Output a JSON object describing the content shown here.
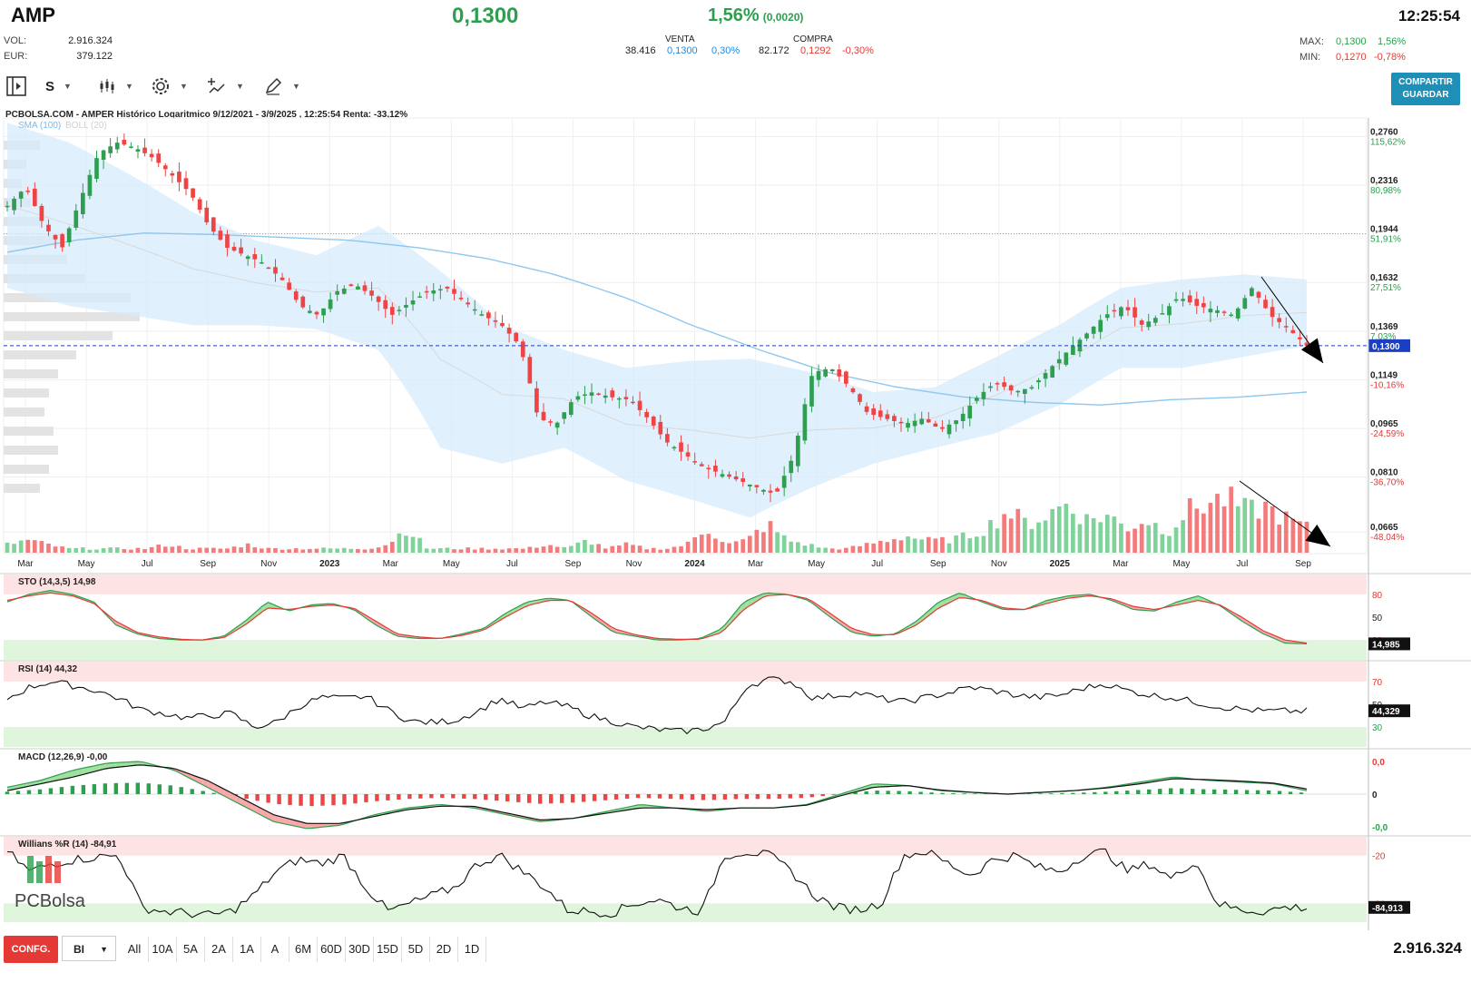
{
  "header": {
    "ticker": "AMP",
    "price": "0,1300",
    "change_pct": "1,56%",
    "change_abs": "(0,0020)",
    "time": "12:25:54",
    "vol_label": "VOL:",
    "vol_value": "2.916.324",
    "eur_label": "EUR:",
    "eur_value": "379.122",
    "max_label": "MAX:",
    "max_price": "0,1300",
    "max_pct": "1,56%",
    "min_label": "MIN:",
    "min_price": "0,1270",
    "min_pct": "-0,78%"
  },
  "orderbook": {
    "sell_label": "VENTA",
    "sell_qty": "38.416",
    "sell_price": "0,1300",
    "sell_pct": "0,30%",
    "buy_label": "COMPRA",
    "buy_qty": "82.172",
    "buy_price": "0,1292",
    "buy_pct": "-0,30%"
  },
  "toolbar": {
    "period_label": "S",
    "share_line1": "COMPARTIR",
    "share_line2": "GUARDAR"
  },
  "bottom": {
    "config_label": "CONFG.",
    "select_value": "BI",
    "ranges": [
      "All",
      "10A",
      "5A",
      "2A",
      "1A",
      "A",
      "6M",
      "60D",
      "30D",
      "15D",
      "5D",
      "2D",
      "1D"
    ],
    "total_volume": "2.916.324"
  },
  "chart_data": {
    "type": "candlestick",
    "title": "PCBOLSA.COM - AMPER Histórico Logaritmico 9/12/2021 - 3/9/2025 , 12:25:54 Renta: -33,12%",
    "legend": [
      "SMA (100)",
      "BOLL (20)"
    ],
    "scale": "log",
    "current_price": 0.13,
    "current_price_label": "0,1300",
    "y_ticks": [
      {
        "value": 0.276,
        "label": "0,2760",
        "pct": "115,62%"
      },
      {
        "value": 0.2316,
        "label": "0,2316",
        "pct": "80,98%"
      },
      {
        "value": 0.1944,
        "label": "0,1944",
        "pct": "51,91%"
      },
      {
        "value": 0.1632,
        "label": "0,1632",
        "pct": "27,51%"
      },
      {
        "value": 0.1369,
        "label": "0,1369",
        "pct": "7,03%"
      },
      {
        "value": 0.1149,
        "label": "0,1149",
        "pct": "-10,16%"
      },
      {
        "value": 0.0965,
        "label": "0,0965",
        "pct": "-24,59%"
      },
      {
        "value": 0.081,
        "label": "0,0810",
        "pct": "-36,70%"
      },
      {
        "value": 0.0665,
        "label": "0,0665",
        "pct": "-48,04%"
      }
    ],
    "x_ticks": [
      "Mar",
      "May",
      "Jul",
      "Sep",
      "Nov",
      "2023",
      "Mar",
      "May",
      "Jul",
      "Sep",
      "Nov",
      "2024",
      "Mar",
      "May",
      "Jul",
      "Sep",
      "Nov",
      "2025",
      "Mar",
      "May",
      "Jul",
      "Sep"
    ],
    "close_path": [
      0.215,
      0.23,
      0.2,
      0.185,
      0.22,
      0.26,
      0.27,
      0.265,
      0.255,
      0.24,
      0.225,
      0.2,
      0.185,
      0.18,
      0.175,
      0.165,
      0.15,
      0.145,
      0.158,
      0.162,
      0.155,
      0.145,
      0.152,
      0.158,
      0.16,
      0.152,
      0.145,
      0.14,
      0.13,
      0.1,
      0.098,
      0.108,
      0.11,
      0.108,
      0.107,
      0.1,
      0.092,
      0.088,
      0.084,
      0.082,
      0.08,
      0.078,
      0.076,
      0.088,
      0.118,
      0.12,
      0.112,
      0.102,
      0.1,
      0.098,
      0.1,
      0.096,
      0.1,
      0.108,
      0.114,
      0.11,
      0.112,
      0.12,
      0.128,
      0.136,
      0.145,
      0.15,
      0.14,
      0.145,
      0.155,
      0.15,
      0.148,
      0.145,
      0.16,
      0.145,
      0.138,
      0.13
    ],
    "sma100_path": [
      0.182,
      0.19,
      0.195,
      0.194,
      0.192,
      0.19,
      0.185,
      0.178,
      0.168,
      0.155,
      0.14,
      0.128,
      0.118,
      0.112,
      0.108,
      0.106,
      0.105,
      0.107,
      0.108,
      0.11
    ],
    "boll_upper_path": [
      0.29,
      0.27,
      0.24,
      0.21,
      0.19,
      0.18,
      0.2,
      0.17,
      0.14,
      0.128,
      0.12,
      0.123,
      0.124,
      0.118,
      0.11,
      0.112,
      0.125,
      0.14,
      0.16,
      0.165,
      0.168,
      0.165
    ],
    "boll_lower_path": [
      0.16,
      0.15,
      0.145,
      0.14,
      0.14,
      0.138,
      0.128,
      0.09,
      0.085,
      0.09,
      0.08,
      0.075,
      0.07,
      0.078,
      0.085,
      0.09,
      0.095,
      0.105,
      0.12,
      0.12,
      0.125,
      0.13
    ],
    "volume_path": [
      2,
      3,
      2,
      1,
      1,
      1,
      1,
      1,
      2,
      1,
      1,
      1,
      2,
      1,
      1,
      1,
      1,
      1,
      1,
      2,
      6,
      1,
      1,
      1,
      1,
      1,
      1,
      2,
      1,
      3,
      1,
      2,
      1,
      1,
      2,
      6,
      2,
      3,
      7,
      3,
      2,
      1,
      1,
      2,
      3,
      4,
      3,
      3,
      4,
      6,
      10,
      7,
      9,
      12,
      8,
      9,
      6,
      8,
      5,
      10,
      12,
      13,
      10,
      11,
      8,
      6
    ],
    "indicators": [
      {
        "name": "STO (14,3,5)",
        "value": "14,98",
        "last_label": "14,985",
        "levels": [
          "80",
          "50",
          "20"
        ],
        "k_path": [
          70,
          80,
          85,
          80,
          70,
          40,
          28,
          22,
          20,
          20,
          25,
          45,
          70,
          58,
          66,
          68,
          60,
          40,
          25,
          22,
          22,
          28,
          35,
          55,
          70,
          75,
          72,
          50,
          30,
          25,
          20,
          20,
          22,
          35,
          70,
          82,
          80,
          72,
          50,
          30,
          25,
          28,
          45,
          70,
          82,
          70,
          60,
          60,
          72,
          78,
          80,
          72,
          60,
          58,
          70,
          78,
          65,
          45,
          28,
          16,
          15
        ],
        "d_path": [
          72,
          78,
          82,
          78,
          68,
          45,
          30,
          24,
          21,
          20,
          23,
          40,
          62,
          60,
          64,
          66,
          62,
          45,
          28,
          24,
          22,
          26,
          33,
          50,
          65,
          72,
          72,
          55,
          35,
          27,
          22,
          21,
          21,
          30,
          60,
          78,
          80,
          74,
          55,
          35,
          27,
          27,
          40,
          62,
          76,
          72,
          62,
          60,
          68,
          75,
          78,
          74,
          64,
          60,
          66,
          72,
          66,
          50,
          32,
          20,
          16
        ]
      },
      {
        "name": "RSI (14)",
        "value": "44,32",
        "last_label": "44,329",
        "levels": [
          "70",
          "50",
          "30"
        ],
        "path": [
          55,
          65,
          70,
          66,
          62,
          55,
          45,
          42,
          38,
          40,
          42,
          30,
          34,
          48,
          56,
          55,
          57,
          45,
          35,
          34,
          36,
          44,
          55,
          46,
          52,
          48,
          40,
          35,
          30,
          28,
          26,
          28,
          34,
          66,
          72,
          70,
          55,
          58,
          60,
          55,
          52,
          56,
          60,
          65,
          62,
          58,
          56,
          58,
          64,
          68,
          62,
          58,
          56,
          52,
          48,
          46,
          44,
          44,
          44
        ]
      },
      {
        "name": "MACD (12,26,9)",
        "value": "-0,00",
        "levels": [
          "0,0",
          "0",
          "-0,0"
        ],
        "macd_path": [
          0.2,
          0.4,
          0.7,
          0.9,
          0.95,
          0.7,
          0.2,
          -0.3,
          -0.8,
          -1.0,
          -0.9,
          -0.6,
          -0.4,
          -0.3,
          -0.4,
          -0.6,
          -0.8,
          -0.7,
          -0.5,
          -0.3,
          -0.4,
          -0.5,
          -0.4,
          -0.4,
          -0.3,
          0.0,
          0.3,
          0.25,
          0.1,
          0.05,
          0.0,
          0.05,
          0.1,
          0.2,
          0.35,
          0.5,
          0.4,
          0.35,
          0.3,
          0.1
        ],
        "signal_path": [
          0.1,
          0.3,
          0.5,
          0.75,
          0.85,
          0.75,
          0.4,
          -0.1,
          -0.6,
          -0.85,
          -0.85,
          -0.65,
          -0.45,
          -0.35,
          -0.35,
          -0.55,
          -0.75,
          -0.7,
          -0.55,
          -0.4,
          -0.4,
          -0.45,
          -0.4,
          -0.4,
          -0.32,
          -0.05,
          0.2,
          0.25,
          0.12,
          0.05,
          0.0,
          0.05,
          0.1,
          0.18,
          0.3,
          0.45,
          0.42,
          0.38,
          0.32,
          0.15
        ]
      },
      {
        "name": "Willians %R (14)",
        "value": "-84,91",
        "last_label": "-84,913",
        "levels": [
          "-20",
          "-50",
          "-80"
        ],
        "path": [
          -15,
          -40,
          -30,
          -25,
          -22,
          -20,
          -85,
          -90,
          -92,
          -95,
          -90,
          -70,
          -40,
          -25,
          -30,
          -20,
          -60,
          -90,
          -80,
          -70,
          -60,
          -30,
          -20,
          -40,
          -60,
          -88,
          -90,
          -92,
          -80,
          -75,
          -85,
          -90,
          -20,
          -15,
          -20,
          -40,
          -70,
          -85,
          -88,
          -80,
          -20,
          -15,
          -30,
          -45,
          -25,
          -20,
          -35,
          -40,
          -20,
          -15,
          -40,
          -30,
          -50,
          -25,
          -80,
          -88,
          -90,
          -85,
          -85
        ]
      }
    ],
    "watermark": "PCBolsa"
  }
}
